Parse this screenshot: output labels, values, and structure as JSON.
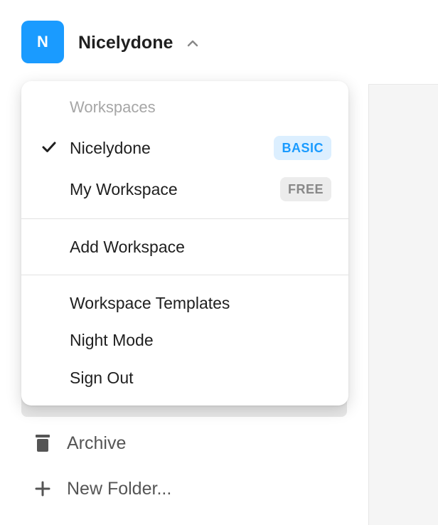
{
  "header": {
    "avatar_letter": "N",
    "workspace_name": "Nicelydone"
  },
  "menu": {
    "heading": "Workspaces",
    "workspaces": [
      {
        "name": "Nicelydone",
        "badge": "BASIC",
        "selected": true
      },
      {
        "name": "My Workspace",
        "badge": "FREE",
        "selected": false
      }
    ],
    "add_workspace": "Add Workspace",
    "items": [
      "Workspace Templates",
      "Night Mode",
      "Sign Out"
    ]
  },
  "sidebar": {
    "archive_label": "Archive",
    "new_folder_label": "New Folder..."
  },
  "colors": {
    "accent": "#1a9bff",
    "basic_badge_bg": "#dcefff",
    "free_badge_bg": "#ececec"
  }
}
